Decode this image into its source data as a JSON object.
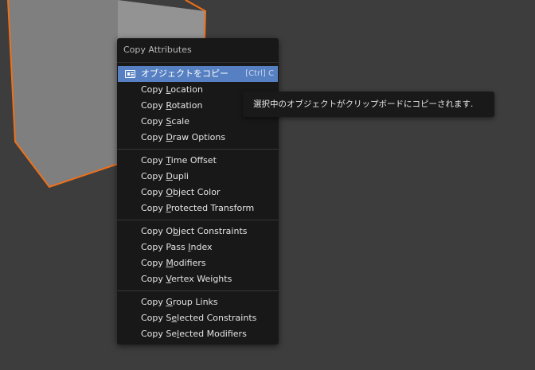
{
  "viewport": {
    "background": "#3d3d3d",
    "cube_color": "#8e8e8e",
    "selection_outline_color": "#f07018"
  },
  "menu": {
    "title": "Copy Attributes",
    "active_item": {
      "label": "オブジェクトをコピー",
      "shortcut": "[Ctrl] C",
      "icon": "copy-object-icon"
    },
    "groups": [
      [
        {
          "prefix": "Copy ",
          "accel": "L",
          "rest": "ocation"
        },
        {
          "prefix": "Copy ",
          "accel": "R",
          "rest": "otation"
        },
        {
          "prefix": "Copy ",
          "accel": "S",
          "rest": "cale"
        },
        {
          "prefix": "Copy ",
          "accel": "D",
          "rest": "raw Options"
        }
      ],
      [
        {
          "prefix": "Copy ",
          "accel": "T",
          "rest": "ime Offset"
        },
        {
          "prefix": "Copy ",
          "accel": "D",
          "rest": "upli"
        },
        {
          "prefix": "Copy ",
          "accel": "O",
          "rest": "bject Color"
        },
        {
          "prefix": "Copy ",
          "accel": "P",
          "rest": "rotected Transform"
        }
      ],
      [
        {
          "prefix": "Copy O",
          "accel": "b",
          "rest": "ject Constraints"
        },
        {
          "prefix": "Copy Pass ",
          "accel": "I",
          "rest": "ndex"
        },
        {
          "prefix": "Copy ",
          "accel": "M",
          "rest": "odifiers"
        },
        {
          "prefix": "Copy ",
          "accel": "V",
          "rest": "ertex Weights"
        }
      ],
      [
        {
          "prefix": "Copy ",
          "accel": "G",
          "rest": "roup Links"
        },
        {
          "prefix": "Copy S",
          "accel": "e",
          "rest": "lected Constraints"
        },
        {
          "prefix": "Copy Se",
          "accel": "l",
          "rest": "ected Modifiers"
        }
      ]
    ]
  },
  "tooltip": {
    "text": "選択中のオブジェクトがクリップボードにコピーされます."
  }
}
